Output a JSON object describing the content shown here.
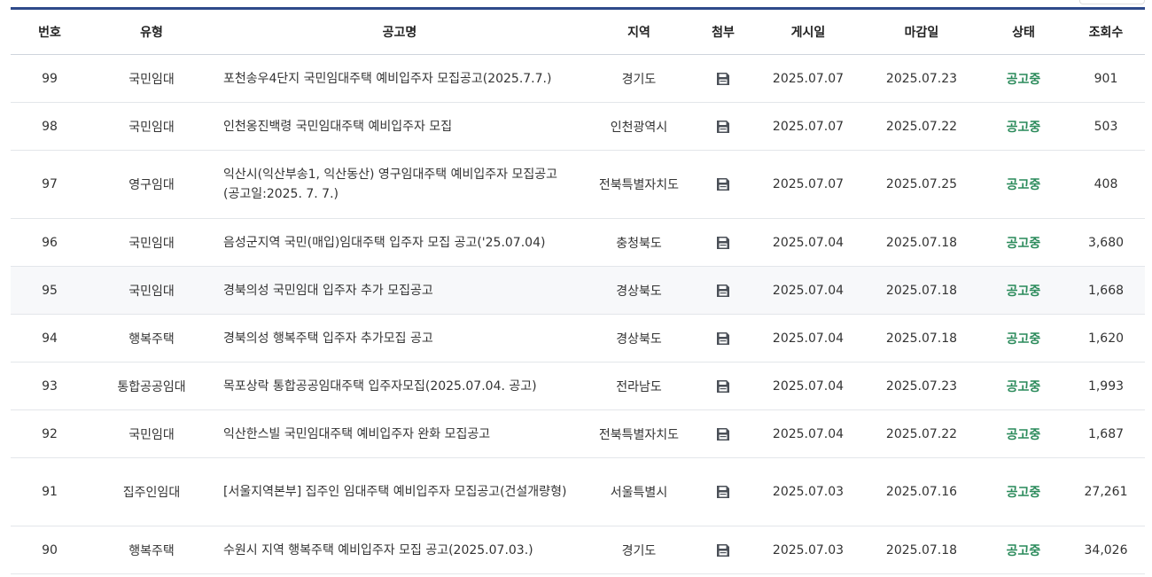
{
  "columns": {
    "no": "번호",
    "type": "유형",
    "title": "공고명",
    "region": "지역",
    "attach": "첨부",
    "posted": "게시일",
    "deadline": "마감일",
    "status": "상태",
    "views": "조회수"
  },
  "colors": {
    "header_border": "#2e4a8a",
    "status_open": "#2a8a5a"
  },
  "rows": [
    {
      "no": "99",
      "type": "국민임대",
      "title": "포천송우4단지 국민임대주택 예비입주자 모집공고(2025.7.7.)",
      "region": "경기도",
      "attach_icon": "save-icon",
      "posted": "2025.07.07",
      "deadline": "2025.07.23",
      "status": "공고중",
      "views": "901"
    },
    {
      "no": "98",
      "type": "국민임대",
      "title": "인천옹진백령 국민임대주택 예비입주자 모집",
      "region": "인천광역시",
      "attach_icon": "save-icon",
      "posted": "2025.07.07",
      "deadline": "2025.07.22",
      "status": "공고중",
      "views": "503"
    },
    {
      "no": "97",
      "type": "영구임대",
      "title": "익산시(익산부송1, 익산동산) 영구임대주택 예비입주자 모집공고(공고일:2025. 7. 7.)",
      "region": "전북특별자치도",
      "attach_icon": "save-icon",
      "posted": "2025.07.07",
      "deadline": "2025.07.25",
      "status": "공고중",
      "views": "408"
    },
    {
      "no": "96",
      "type": "국민임대",
      "title": "음성군지역 국민(매입)임대주택 입주자 모집 공고('25.07.04)",
      "region": "충청북도",
      "attach_icon": "save-icon",
      "posted": "2025.07.04",
      "deadline": "2025.07.18",
      "status": "공고중",
      "views": "3,680"
    },
    {
      "no": "95",
      "type": "국민임대",
      "title": "경북의성 국민임대 입주자 추가 모집공고",
      "region": "경상북도",
      "attach_icon": "save-icon",
      "posted": "2025.07.04",
      "deadline": "2025.07.18",
      "status": "공고중",
      "views": "1,668"
    },
    {
      "no": "94",
      "type": "행복주택",
      "title": "경북의성 행복주택 입주자 추가모집 공고",
      "region": "경상북도",
      "attach_icon": "save-icon",
      "posted": "2025.07.04",
      "deadline": "2025.07.18",
      "status": "공고중",
      "views": "1,620"
    },
    {
      "no": "93",
      "type": "통합공공임대",
      "title": "목포상락 통합공공임대주택 입주자모집(2025.07.04. 공고)",
      "region": "전라남도",
      "attach_icon": "save-icon",
      "posted": "2025.07.04",
      "deadline": "2025.07.23",
      "status": "공고중",
      "views": "1,993"
    },
    {
      "no": "92",
      "type": "국민임대",
      "title": "익산한스빌 국민임대주택 예비입주자 완화 모집공고",
      "region": "전북특별자치도",
      "attach_icon": "save-icon",
      "posted": "2025.07.04",
      "deadline": "2025.07.22",
      "status": "공고중",
      "views": "1,687"
    },
    {
      "no": "91",
      "type": "집주인임대",
      "title": "[서울지역본부] 집주인 임대주택 예비입주자 모집공고(건설개량형)",
      "region": "서울특별시",
      "attach_icon": "save-icon",
      "posted": "2025.07.03",
      "deadline": "2025.07.16",
      "status": "공고중",
      "views": "27,261"
    },
    {
      "no": "90",
      "type": "행복주택",
      "title": "수원시 지역 행복주택 예비입주자 모집 공고(2025.07.03.)",
      "region": "경기도",
      "attach_icon": "save-icon",
      "posted": "2025.07.03",
      "deadline": "2025.07.18",
      "status": "공고중",
      "views": "34,026"
    }
  ]
}
